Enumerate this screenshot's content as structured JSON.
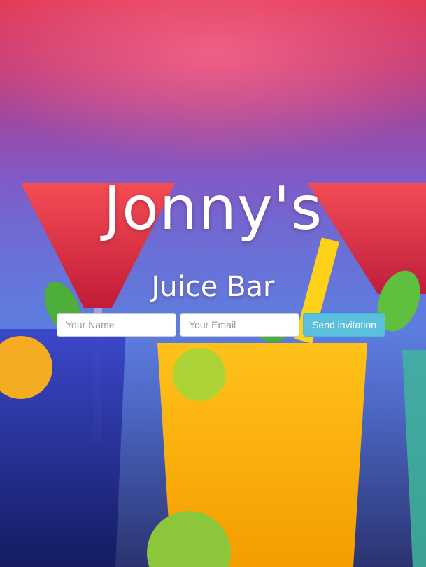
{
  "hero": {
    "title": "Jonny's",
    "subtitle": "Juice Bar"
  },
  "form": {
    "name_placeholder": "Your Name",
    "email_placeholder": "Your Email",
    "submit_label": "Send invitation"
  },
  "colors": {
    "button": "#5bc0de",
    "text": "#ffffff"
  }
}
